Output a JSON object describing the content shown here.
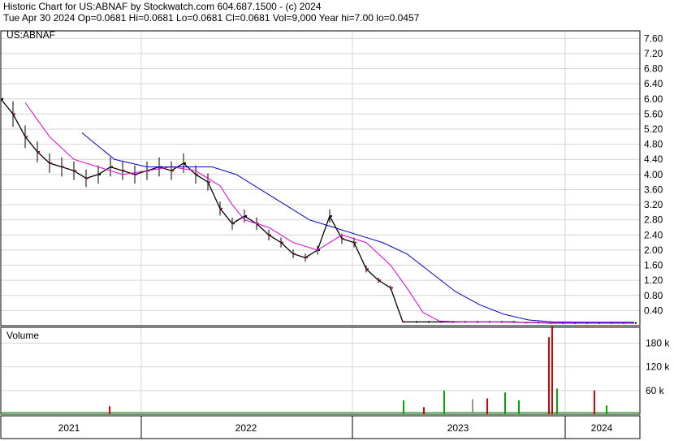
{
  "header": {
    "line1": "Historic Chart for US:ABNAF by Stockwatch.com 604.687.1500 - (c) 2024",
    "line2": "Tue Apr 30 2024   Op=0.0681   Hi=0.0681   Lo=0.0681   Cl=0.0681   Vol=9,000   Year hi=7.00   lo=0.0457"
  },
  "chart_data": [
    {
      "type": "line",
      "title": "US:ABNAF",
      "ylim": [
        0,
        7.8
      ],
      "y_ticks": [
        "7.60",
        "7.20",
        "6.80",
        "6.40",
        "6.00",
        "5.60",
        "5.20",
        "4.80",
        "4.40",
        "4.00",
        "3.60",
        "3.20",
        "2.80",
        "2.40",
        "2.00",
        "1.60",
        "1.20",
        "0.80",
        "0.40"
      ],
      "x_ticks": [
        "2021",
        "2022",
        "2023",
        "2024"
      ],
      "grid": true,
      "colors": {
        "price": "#000000",
        "down_close": "#cc0000",
        "ma_short": "#dd00dd",
        "ma_long": "#0000cc",
        "grid": "#d4d4d4"
      },
      "series": [
        {
          "name": "",
          "role": "price",
          "x": [
            0,
            15,
            30,
            45,
            60,
            75,
            90,
            105,
            120,
            135,
            150,
            165,
            180,
            195,
            210,
            225,
            240,
            255,
            270,
            285,
            300,
            315,
            330,
            345,
            360,
            375,
            390,
            405,
            420,
            435,
            450,
            465,
            480,
            495,
            510,
            525,
            540,
            555,
            570,
            585,
            600,
            615,
            630,
            645,
            660,
            675,
            690,
            705,
            720,
            735,
            750,
            765,
            780
          ],
          "values": [
            6.0,
            5.6,
            5.0,
            4.6,
            4.3,
            4.2,
            4.1,
            3.9,
            4.0,
            4.2,
            4.1,
            4.0,
            4.1,
            4.2,
            4.1,
            4.3,
            4.0,
            3.8,
            3.1,
            2.7,
            2.9,
            2.7,
            2.4,
            2.2,
            1.9,
            1.8,
            2.0,
            2.9,
            2.3,
            2.2,
            1.5,
            1.2,
            1.0,
            0.1,
            0.1,
            0.1,
            0.1,
            0.1,
            0.1,
            0.1,
            0.1,
            0.1,
            0.1,
            0.08,
            0.08,
            0.07,
            0.07,
            0.07,
            0.07,
            0.07,
            0.07,
            0.07,
            0.07
          ]
        },
        {
          "name": "",
          "role": "ma_short",
          "x": [
            30,
            60,
            90,
            120,
            150,
            180,
            210,
            240,
            270,
            285,
            300,
            330,
            360,
            390,
            420,
            450,
            480,
            500,
            520,
            540,
            570,
            600,
            660,
            720,
            780
          ],
          "values": [
            5.9,
            5.0,
            4.4,
            4.2,
            4.0,
            4.1,
            4.2,
            4.1,
            3.7,
            3.2,
            2.8,
            2.6,
            2.2,
            2.0,
            2.4,
            2.2,
            1.6,
            1.0,
            0.35,
            0.12,
            0.1,
            0.1,
            0.08,
            0.07,
            0.07
          ]
        },
        {
          "name": "",
          "role": "ma_long",
          "x": [
            100,
            140,
            180,
            220,
            260,
            290,
            320,
            350,
            380,
            410,
            440,
            470,
            500,
            530,
            560,
            590,
            620,
            650,
            680,
            720,
            780
          ],
          "values": [
            5.1,
            4.4,
            4.2,
            4.2,
            4.2,
            4.0,
            3.6,
            3.2,
            2.8,
            2.6,
            2.4,
            2.2,
            1.9,
            1.4,
            0.9,
            0.55,
            0.3,
            0.15,
            0.1,
            0.09,
            0.09
          ]
        }
      ]
    },
    {
      "type": "bar",
      "title": "Volume",
      "ylim": [
        0,
        220
      ],
      "y_unit": "k",
      "y_ticks": [
        "180 k",
        "120 k",
        "60 k"
      ],
      "colors": {
        "up": "#00aa00",
        "down": "#dd0000",
        "flat": "#999999"
      },
      "bars": [
        {
          "x": 133,
          "value": 20,
          "dir": "down"
        },
        {
          "x": 495,
          "value": 35,
          "dir": "up"
        },
        {
          "x": 520,
          "value": 18,
          "dir": "down"
        },
        {
          "x": 545,
          "value": 60,
          "dir": "up"
        },
        {
          "x": 580,
          "value": 38,
          "dir": "flat"
        },
        {
          "x": 598,
          "value": 40,
          "dir": "down"
        },
        {
          "x": 620,
          "value": 55,
          "dir": "up"
        },
        {
          "x": 637,
          "value": 35,
          "dir": "up"
        },
        {
          "x": 674,
          "value": 195,
          "dir": "down"
        },
        {
          "x": 678,
          "value": 225,
          "dir": "down"
        },
        {
          "x": 684,
          "value": 65,
          "dir": "up"
        },
        {
          "x": 730,
          "value": 60,
          "dir": "down"
        },
        {
          "x": 745,
          "value": 22,
          "dir": "up"
        }
      ]
    }
  ]
}
